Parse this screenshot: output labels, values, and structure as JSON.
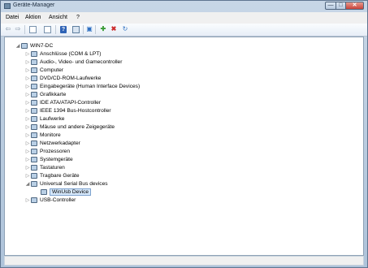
{
  "window": {
    "title": "Geräte-Manager"
  },
  "menubar": {
    "items": [
      "Datei",
      "Aktion",
      "Ansicht",
      "?"
    ]
  },
  "caption": {
    "minimize": "—",
    "maximize": "□",
    "close": "✕"
  },
  "toolbar": {
    "icons": [
      "back-arrow-icon",
      "forward-arrow-icon",
      "properties-icon",
      "doc-icon",
      "help-icon",
      "device-icon",
      "update-driver-icon",
      "disable-device-icon",
      "scan-hardware-icon"
    ]
  },
  "tree": {
    "items": [
      {
        "label": "WIN7-DC",
        "expander": "◢",
        "level": 0
      },
      {
        "label": "Anschlüsse (COM & LPT)",
        "expander": "▷",
        "level": 1
      },
      {
        "label": "Audio-, Video- und Gamecontroller",
        "expander": "▷",
        "level": 1
      },
      {
        "label": "Computer",
        "expander": "▷",
        "level": 1
      },
      {
        "label": "DVD/CD-ROM-Laufwerke",
        "expander": "▷",
        "level": 1
      },
      {
        "label": "Eingabegeräte (Human Interface Devices)",
        "expander": "▷",
        "level": 1
      },
      {
        "label": "Grafikkarte",
        "expander": "▷",
        "level": 1
      },
      {
        "label": "IDE ATA/ATAPI-Controller",
        "expander": "▷",
        "level": 1
      },
      {
        "label": "IEEE 1394 Bus-Hostcontroller",
        "expander": "▷",
        "level": 1
      },
      {
        "label": "Laufwerke",
        "expander": "▷",
        "level": 1
      },
      {
        "label": "Mäuse und andere Zeigegeräte",
        "expander": "▷",
        "level": 1
      },
      {
        "label": "Monitore",
        "expander": "▷",
        "level": 1
      },
      {
        "label": "Netzwerkadapter",
        "expander": "▷",
        "level": 1
      },
      {
        "label": "Prozessoren",
        "expander": "▷",
        "level": 1
      },
      {
        "label": "Systemgeräte",
        "expander": "▷",
        "level": 1
      },
      {
        "label": "Tastaturen",
        "expander": "▷",
        "level": 1
      },
      {
        "label": "Tragbare Geräte",
        "expander": "▷",
        "level": 1
      },
      {
        "label": "Universal Serial Bus devices",
        "expander": "◢",
        "level": 1
      },
      {
        "label": "WinUsb Device",
        "expander": "",
        "level": 2,
        "selected": true
      },
      {
        "label": "USB-Controller",
        "expander": "▷",
        "level": 1
      }
    ]
  }
}
